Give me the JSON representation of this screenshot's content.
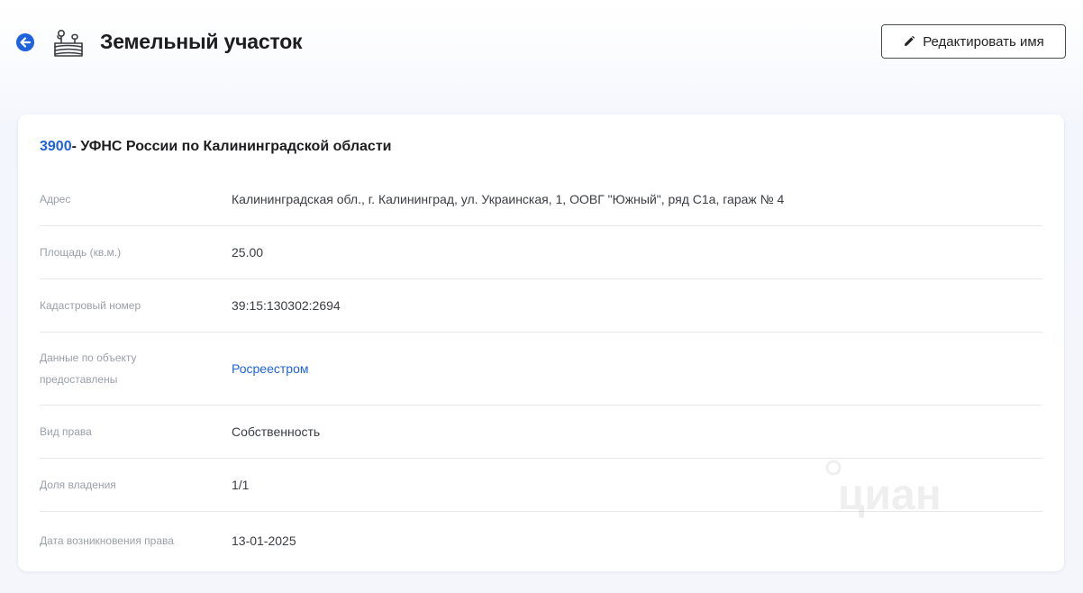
{
  "header": {
    "title": "Земельный участок",
    "edit_label": "Редактировать имя",
    "back_icon": "arrow-left-circle-icon",
    "land_icon": "land-plot-icon"
  },
  "card": {
    "code": "3900",
    "authority": "- УФНС России по Калининградской области",
    "rows": [
      {
        "label": "Адрес",
        "value": "Калининградская обл., г. Калининград, ул. Украинская, 1, ООВГ \"Южный\", ряд С1а, гараж № 4"
      },
      {
        "label": "Площадь (кв.м.)",
        "value": "25.00"
      },
      {
        "label": "Кадастровый номер",
        "value": "39:15:130302:2694"
      },
      {
        "label": "Данные по объекту предоставлены",
        "value": "Росреестром"
      },
      {
        "label": "Вид права",
        "value": "Собственность"
      },
      {
        "label": "Доля владения",
        "value": "1/1"
      },
      {
        "label": "Дата возникновения права",
        "value": "13-01-2025"
      }
    ]
  },
  "colors": {
    "accent": "#1f62dd",
    "label": "#9aa0a8",
    "value": "#3a3d42"
  },
  "watermark_text": "циан"
}
